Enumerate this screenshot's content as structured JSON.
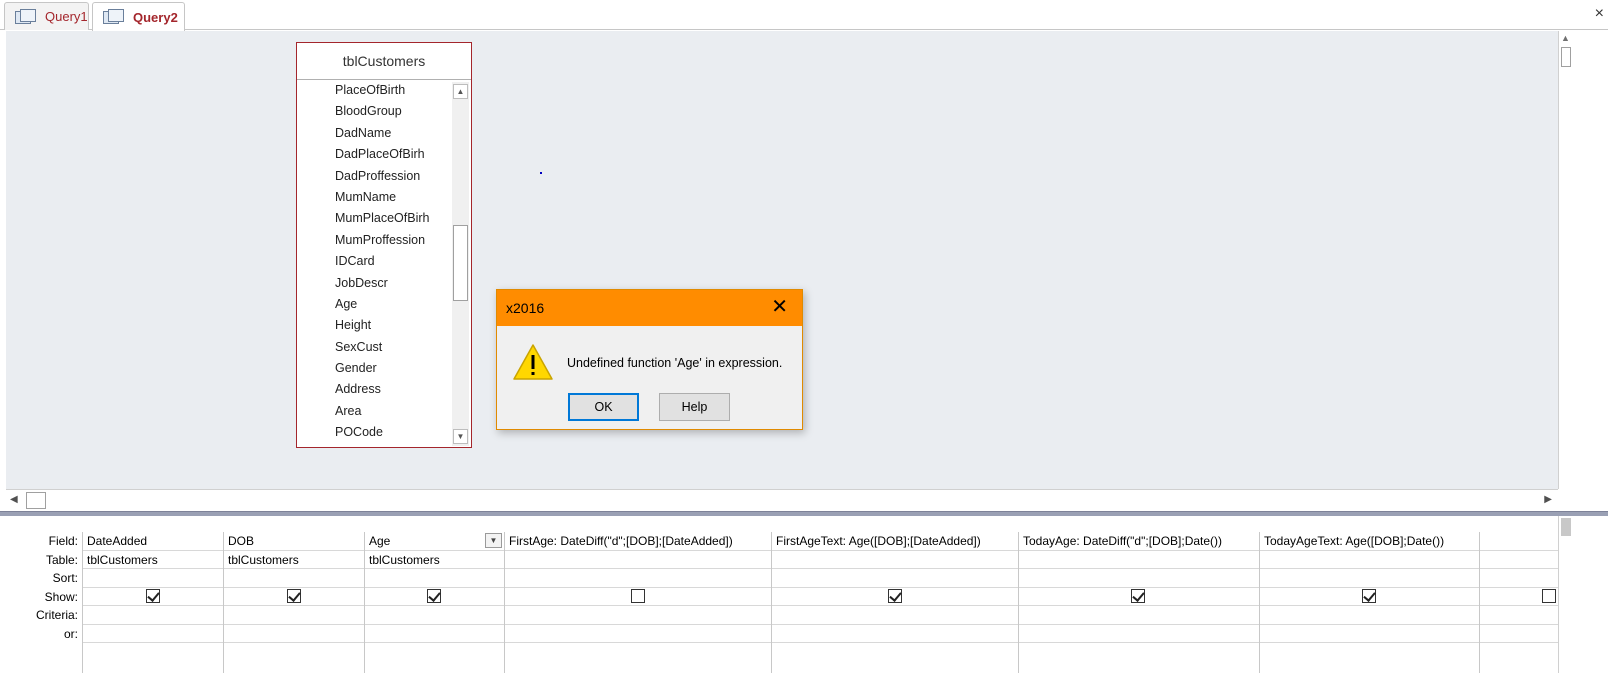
{
  "tabs": [
    {
      "label": "Query1",
      "active": false
    },
    {
      "label": "Query2",
      "active": true
    }
  ],
  "window": {
    "close_glyph": "×"
  },
  "field_list": {
    "title": "tblCustomers",
    "fields": [
      "PlaceOfBirth",
      "BloodGroup",
      "DadName",
      "DadPlaceOfBirh",
      "DadProffession",
      "MumName",
      "MumPlaceOfBirh",
      "MumProffession",
      "IDCard",
      "JobDescr",
      "Age",
      "Height",
      "SexCust",
      "Gender",
      "Address",
      "Area",
      "POCode"
    ]
  },
  "dialog": {
    "title": "x2016",
    "close_glyph": "✕",
    "message": "Undefined function 'Age' in expression.",
    "ok_label": "OK",
    "help_label": "Help",
    "icon": "warning-icon"
  },
  "grid": {
    "row_labels": [
      "Field:",
      "Table:",
      "Sort:",
      "Show:",
      "Criteria:",
      "or:"
    ],
    "columns": [
      {
        "field": "DateAdded",
        "table": "tblCustomers",
        "show": true
      },
      {
        "field": "DOB",
        "table": "tblCustomers",
        "show": true
      },
      {
        "field": "Age",
        "table": "tblCustomers",
        "show": true,
        "has_dropdown": true
      },
      {
        "field": "FirstAge: DateDiff(\"d\";[DOB];[DateAdded])",
        "table": "",
        "show": false
      },
      {
        "field": "FirstAgeText: Age([DOB];[DateAdded])",
        "table": "",
        "show": true
      },
      {
        "field": "TodayAge: DateDiff(\"d\";[DOB];Date())",
        "table": "",
        "show": true
      },
      {
        "field": "TodayAgeText: Age([DOB];Date())",
        "table": "",
        "show": true
      },
      {
        "field": "",
        "table": "",
        "show": false
      }
    ]
  },
  "colors": {
    "accent": "#a4262c",
    "dialog_title_bg": "#ff8c00",
    "design_bg": "#eaedf1",
    "ok_border": "#0078d7"
  }
}
